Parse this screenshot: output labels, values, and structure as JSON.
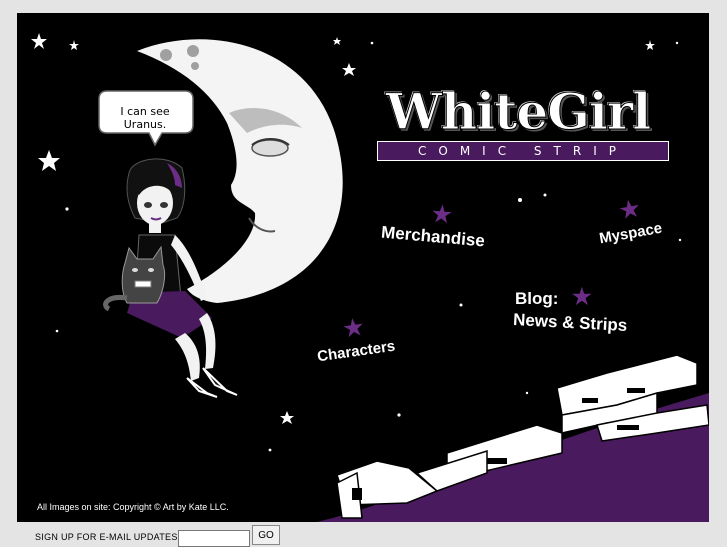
{
  "speech_bubble": "I can see Uranus.",
  "logo": {
    "title": "WhiteGirl",
    "subtitle": "COMIC STRIP"
  },
  "nav": {
    "merchandise": "Merchandise",
    "myspace": "Myspace",
    "blog_line1": "Blog:",
    "blog_line2": "News & Strips",
    "characters": "Characters"
  },
  "copyright": "All Images on site: Copyright © Art by Kate LLC.",
  "signup": {
    "label": "SIGN UP FOR E-MAIL UPDATES",
    "email_value": "",
    "button": "GO"
  },
  "colors": {
    "accent": "#4a1a5e",
    "star_purple": "#6b2d85",
    "background": "#000000",
    "frame": "#e4e4e4"
  }
}
